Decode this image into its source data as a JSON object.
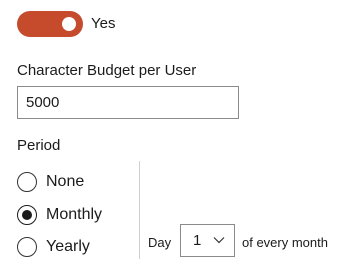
{
  "toggle": {
    "label": "Yes",
    "on": true,
    "color": "#c64a2c"
  },
  "budget": {
    "label": "Character Budget per User",
    "value": "5000"
  },
  "period": {
    "label": "Period",
    "options": [
      {
        "label": "None",
        "checked": false
      },
      {
        "label": "Monthly",
        "checked": true
      },
      {
        "label": "Yearly",
        "checked": false
      }
    ]
  },
  "day": {
    "prefix": "Day",
    "value": "1",
    "suffix": "of every month"
  },
  "icons": {
    "day_dropdown": "chevron-down-icon"
  }
}
